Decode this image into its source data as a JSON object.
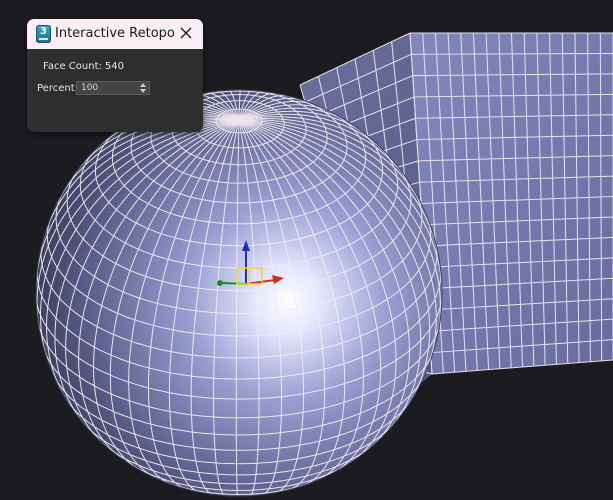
{
  "viewport": {
    "background": "#1c1c20",
    "mesh_fill": "#7a7fb0",
    "wire_color": "#f3ecf2",
    "gizmo_axes": {
      "x": "#d52b1e",
      "y": "#1d8a2e",
      "z": "#1b2ec9"
    }
  },
  "retopo_panel": {
    "title": "Interactive Retopo",
    "app_icon_label": "3",
    "close_icon": "close-icon",
    "face_count_label": "Face Count:",
    "face_count_value": "540",
    "percent_label": "Percent:",
    "percent_value": "100"
  }
}
